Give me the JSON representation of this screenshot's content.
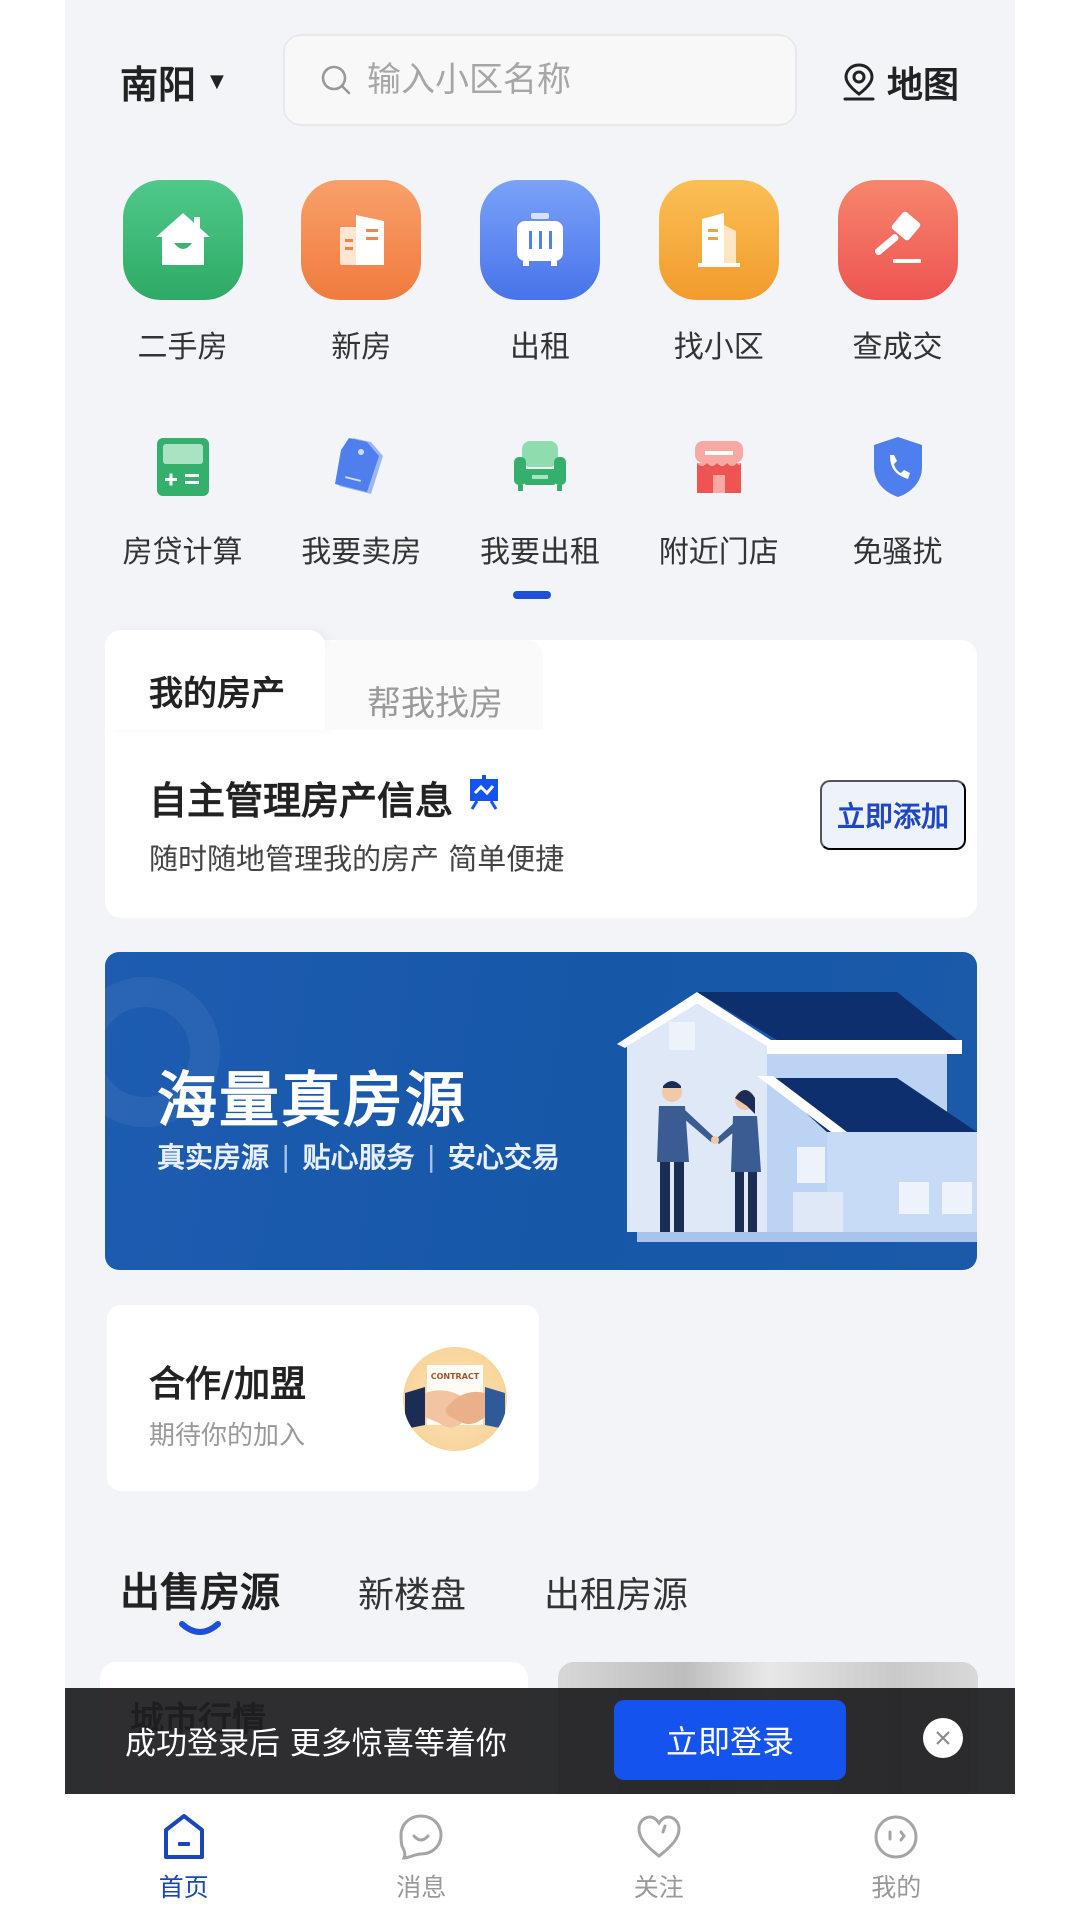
{
  "header": {
    "city": "南阳",
    "search_placeholder": "输入小区名称",
    "map_label": "地图"
  },
  "primary_grid": [
    {
      "label": "二手房",
      "icon": "house-icon",
      "color": "#3cb371"
    },
    {
      "label": "新房",
      "icon": "building-icon",
      "color": "#f2834a"
    },
    {
      "label": "出租",
      "icon": "suitcase-icon",
      "color": "#4f7ff0"
    },
    {
      "label": "找小区",
      "icon": "tower-icon",
      "color": "#f5a53b"
    },
    {
      "label": "查成交",
      "icon": "gavel-icon",
      "color": "#f0605a"
    }
  ],
  "secondary_grid": [
    {
      "label": "房贷计算",
      "icon": "calculator-icon"
    },
    {
      "label": "我要卖房",
      "icon": "price-tag-icon"
    },
    {
      "label": "我要出租",
      "icon": "sofa-icon"
    },
    {
      "label": "附近门店",
      "icon": "storefront-icon"
    },
    {
      "label": "免骚扰",
      "icon": "shield-phone-icon"
    }
  ],
  "property_card": {
    "tabs": [
      "我的房产",
      "帮我找房"
    ],
    "active_tab": "我的房产",
    "title": "自主管理房产信息",
    "subtitle": "随时随地管理我的房产 简单便捷",
    "button_label": "立即添加"
  },
  "banner": {
    "title": "海量真房源",
    "tags": [
      "真实房源",
      "贴心服务",
      "安心交易"
    ]
  },
  "coop_card": {
    "title": "合作/加盟",
    "subtitle": "期待你的加入",
    "image_text": "CONTRACT"
  },
  "listing_tabs": {
    "tabs": [
      "出售房源",
      "新楼盘",
      "出租房源"
    ],
    "active": "出售房源"
  },
  "listing_cards": {
    "left_title": "城市行情"
  },
  "login_toast": {
    "message": "成功登录后 更多惊喜等着你",
    "button_label": "立即登录"
  },
  "bottom_nav": [
    {
      "label": "首页",
      "icon": "home-icon",
      "active": true
    },
    {
      "label": "消息",
      "icon": "message-icon",
      "active": false
    },
    {
      "label": "关注",
      "icon": "heart-icon",
      "active": false
    },
    {
      "label": "我的",
      "icon": "profile-face-icon",
      "active": false
    }
  ],
  "colors": {
    "accent": "#1553ef",
    "nav_active": "#1a47b8",
    "banner_bg": "#1757a8",
    "page_bg": "#f2f4f8"
  }
}
